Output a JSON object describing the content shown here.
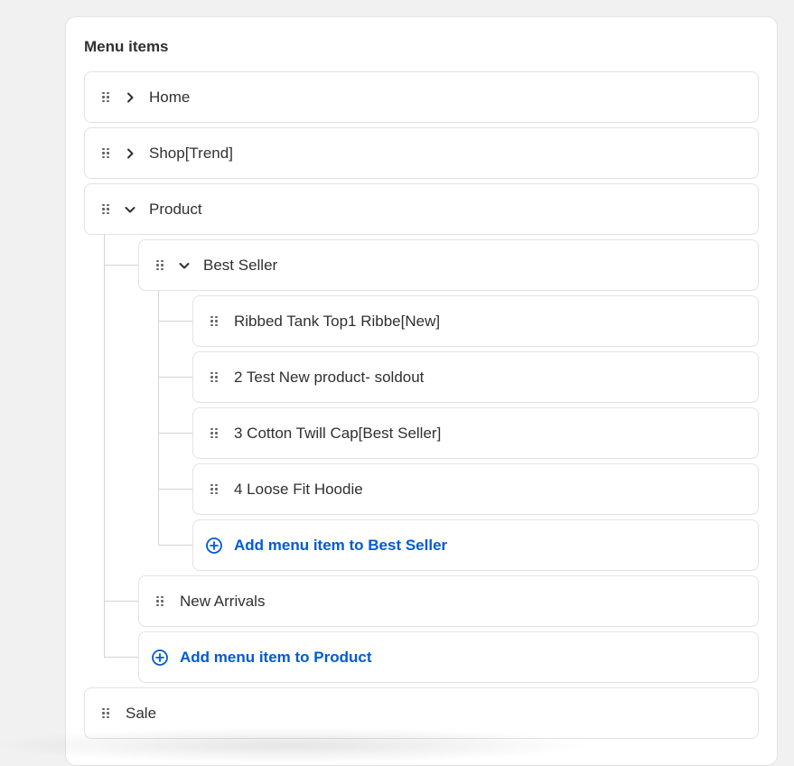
{
  "menu": {
    "title": "Menu items",
    "items": [
      {
        "label": "Home",
        "expanded": false
      },
      {
        "label": "Shop[Trend]",
        "expanded": false
      },
      {
        "label": "Product",
        "expanded": true,
        "children": [
          {
            "label": "Best Seller",
            "expanded": true,
            "children": [
              {
                "label": "Ribbed Tank Top1 Ribbe[New]"
              },
              {
                "label": "2 Test New product- soldout"
              },
              {
                "label": "3 Cotton Twill Cap[Best Seller]"
              },
              {
                "label": "4 Loose Fit Hoodie"
              }
            ],
            "add_label": "Add menu item to Best Seller"
          },
          {
            "label": "New Arrivals"
          }
        ],
        "add_label": "Add menu item to Product"
      },
      {
        "label": "Sale"
      }
    ]
  },
  "colors": {
    "accent": "#005bd3",
    "border": "#e3e3e3",
    "tree_line": "#d4d4d4",
    "background": "#f1f1f1"
  },
  "icons": {
    "handle": "drag-handle-icon",
    "collapsed": "chevron-right-icon",
    "expanded": "chevron-down-icon",
    "add": "plus-circle-icon"
  }
}
